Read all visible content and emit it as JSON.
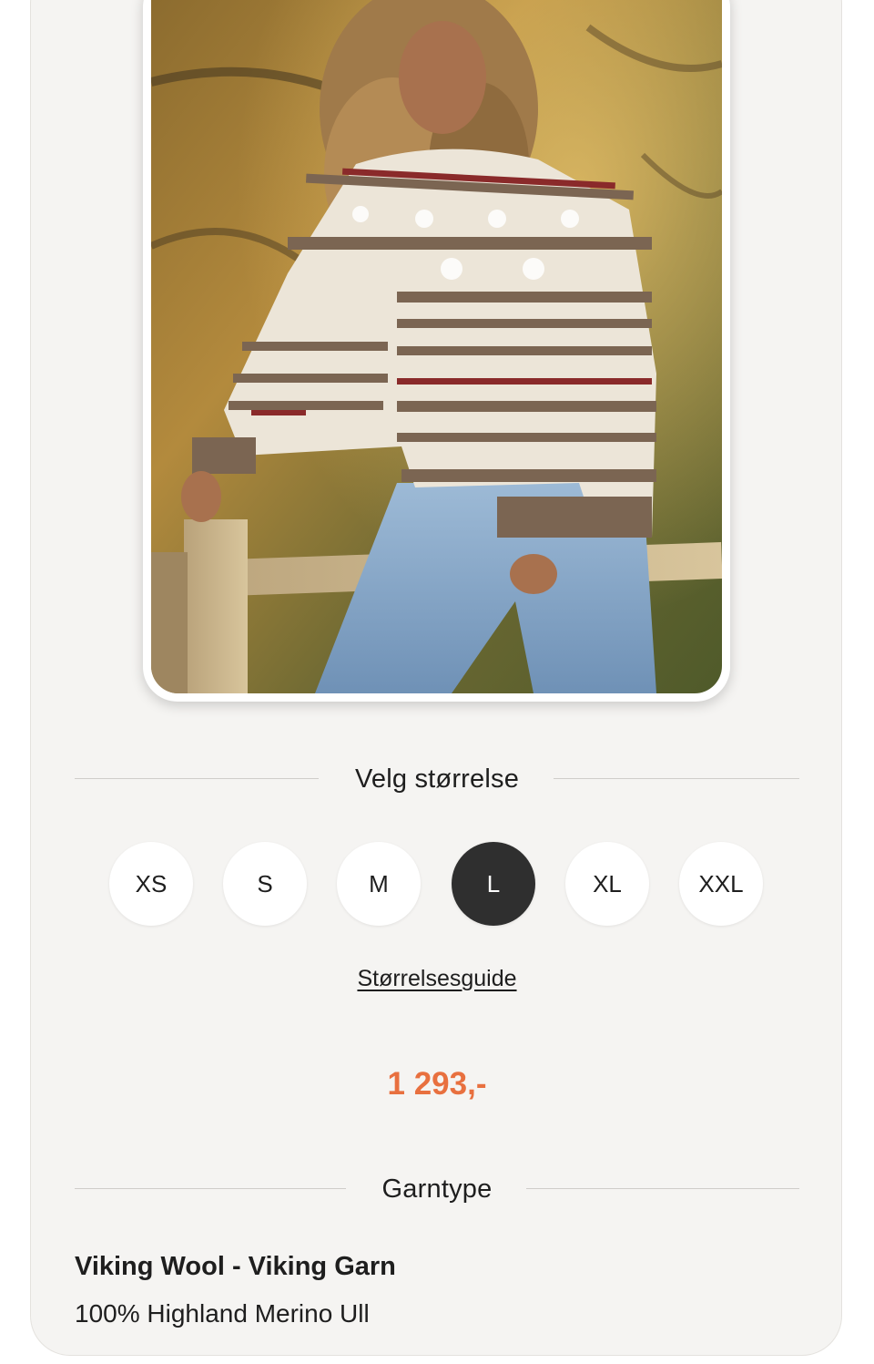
{
  "size_section": {
    "title": "Velg størrelse",
    "sizes": [
      {
        "label": "XS",
        "selected": false
      },
      {
        "label": "S",
        "selected": false
      },
      {
        "label": "M",
        "selected": false
      },
      {
        "label": "L",
        "selected": true
      },
      {
        "label": "XL",
        "selected": false
      },
      {
        "label": "XXL",
        "selected": false
      }
    ],
    "guide_link": "Størrelsesguide"
  },
  "price": "1 293,-",
  "yarn_section": {
    "title": "Garntype",
    "name": "Viking Wool - Viking Garn",
    "description": "100% Highland Merino Ull"
  },
  "colors": {
    "accent_price": "#e8703f",
    "selected_size_bg": "#2f2f2f",
    "card_bg": "#f5f4f2"
  }
}
